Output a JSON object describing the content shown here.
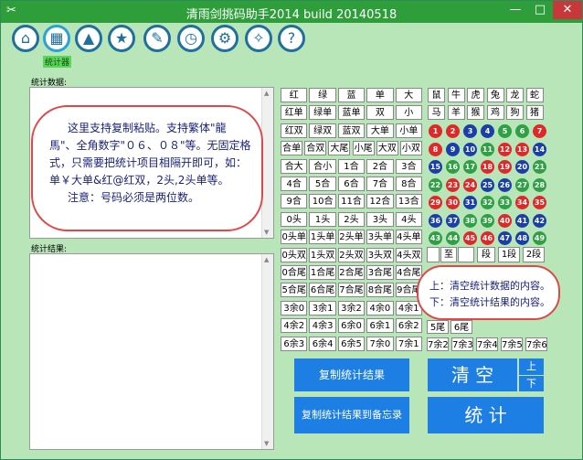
{
  "window": {
    "title": "清雨剑挑码助手2014 build 20140518",
    "min": "—",
    "max": "□",
    "close": "✕",
    "app_icon": "✂"
  },
  "toolbar": {
    "icons": [
      "home-icon",
      "calculator-icon",
      "navigate-icon",
      "star-icon",
      "edit-icon",
      "clock-icon",
      "gear-icon",
      "wrench-icon",
      "help-icon"
    ],
    "glyphs": [
      "⌂",
      "▦",
      "▲",
      "★",
      "✎",
      "◷",
      "⚙",
      "✧",
      "?"
    ],
    "active_caption": "统计器"
  },
  "labels": {
    "data": "统计数据:",
    "result": "统计结果:"
  },
  "hint_bubble": {
    "lines": [
      "这里支持复制粘贴。支持繁体\"龍",
      "馬\"、全角数字\"０６、０８\"等。无固定格",
      "式，只需要把统计项目相隔开即可，如：",
      "单￥大单&红@红双，2头,2头单等。",
      "注意：号码必须是两位数。"
    ]
  },
  "clear_bubble": {
    "line1": "上：清空统计数据的内容。",
    "line2": "下：清空统计结果的内容。"
  },
  "grid_buttons": [
    [
      "红",
      "绿",
      "蓝",
      "单",
      "大"
    ],
    [
      "红单",
      "绿单",
      "蓝单",
      "双",
      "小"
    ],
    [
      "红双",
      "绿双",
      "蓝双",
      "大单",
      "小单"
    ],
    [
      "合单",
      "合双",
      "大尾",
      "小尾",
      "大双",
      "小双"
    ],
    [
      "合大",
      "合小",
      "1合",
      "2合",
      "3合"
    ],
    [
      "4合",
      "5合",
      "6合",
      "7合",
      "8合"
    ],
    [
      "9合",
      "10合",
      "11合",
      "12合",
      "13合"
    ],
    [
      "0头",
      "1头",
      "2头",
      "3头",
      "4头"
    ],
    [
      "0头单",
      "1头单",
      "2头单",
      "3头单",
      "4头单"
    ],
    [
      "0头双",
      "1头双",
      "2头双",
      "3头双",
      "4头双"
    ],
    [
      "0合尾",
      "1合尾",
      "2合尾",
      "3合尾",
      "4合尾"
    ],
    [
      "5合尾",
      "6合尾",
      "7合尾",
      "8合尾",
      "9合尾"
    ],
    [
      "3余0",
      "3余1",
      "3余2",
      "4余0",
      "4余1"
    ],
    [
      "4余2",
      "4余3",
      "6余0",
      "6余1",
      "6余2"
    ],
    [
      "6余3",
      "6余4",
      "6余5",
      "7余0",
      "7余1"
    ]
  ],
  "zodiac": [
    [
      "鼠",
      "牛",
      "虎",
      "兔",
      "龙",
      "蛇"
    ],
    [
      "马",
      "羊",
      "猴",
      "鸡",
      "狗",
      "猪"
    ]
  ],
  "balls": [
    [
      "1",
      "2",
      "3",
      "4",
      "5",
      "6",
      "7"
    ],
    [
      "8",
      "9",
      "10",
      "11",
      "12",
      "13",
      "14"
    ],
    [
      "15",
      "16",
      "17",
      "18",
      "19",
      "20",
      "21"
    ],
    [
      "22",
      "23",
      "24",
      "25",
      "26",
      "27",
      "28"
    ],
    [
      "29",
      "30",
      "31",
      "32",
      "33",
      "34",
      "35"
    ],
    [
      "36",
      "37",
      "38",
      "39",
      "40",
      "41",
      "42"
    ],
    [
      "43",
      "44",
      "45",
      "46",
      "47",
      "48",
      "49"
    ]
  ],
  "ball_colors": [
    [
      "red",
      "red",
      "blue",
      "blue",
      "green",
      "green",
      "red"
    ],
    [
      "red",
      "blue",
      "blue",
      "green",
      "red",
      "red",
      "blue"
    ],
    [
      "blue",
      "green",
      "green",
      "red",
      "red",
      "blue",
      "green"
    ],
    [
      "green",
      "red",
      "red",
      "blue",
      "blue",
      "green",
      "green"
    ],
    [
      "red",
      "red",
      "blue",
      "green",
      "green",
      "red",
      "red"
    ],
    [
      "blue",
      "blue",
      "green",
      "green",
      "red",
      "blue",
      "blue"
    ],
    [
      "green",
      "green",
      "red",
      "red",
      "blue",
      "blue",
      "green"
    ]
  ],
  "colors": {
    "red": "#e02828",
    "blue": "#1a3fa8",
    "green": "#2fa044"
  },
  "range": {
    "to": "至",
    "seg": "段",
    "seg1": "1段",
    "seg2": "2段"
  },
  "tail_buttons": [
    [
      "5尾",
      "6尾"
    ],
    [
      "7余2",
      "7余3",
      "7余4",
      "7余5",
      "7余6"
    ]
  ],
  "actions": {
    "copy_result": "复制统计结果",
    "copy_to_memo": "复制统计结果到备忘录",
    "clear": "清 空",
    "clear_up": "上",
    "clear_down": "下",
    "stat": "统  计"
  }
}
